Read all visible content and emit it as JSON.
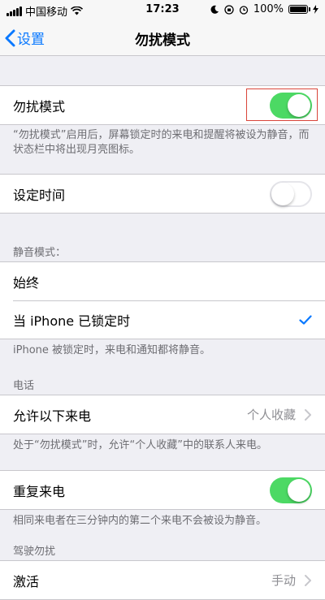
{
  "status_bar": {
    "carrier": "中国移动",
    "time": "17:23",
    "battery_text": "100%"
  },
  "nav": {
    "back_label": "设置",
    "title": "勿扰模式"
  },
  "dnd": {
    "label": "勿扰模式",
    "enabled": true,
    "footnote": "“勿扰模式”启用后，屏幕锁定时的来电和提醒将被设为静音，而状态栏中将出现月亮图标。"
  },
  "scheduled": {
    "label": "设定时间",
    "enabled": false
  },
  "silence": {
    "header": "静音模式：",
    "always_label": "始终",
    "locked_label": "当 iPhone 已锁定时",
    "footnote": "iPhone 被锁定时，来电和通知都将静音。"
  },
  "phone": {
    "header": "电话",
    "allow_label": "允许以下来电",
    "allow_value": "个人收藏",
    "footnote": "处于“勿扰模式”时，允许“个人收藏”中的联系人来电。",
    "repeat_label": "重复来电",
    "repeat_enabled": true,
    "repeat_footnote": "相同来电者在三分钟内的第二个来电不会被设为静音。"
  },
  "driving": {
    "header": "驾驶勿扰",
    "activate_label": "激活",
    "activate_value": "手动"
  },
  "colors": {
    "accent": "#0a79ff",
    "toggle_on": "#4cd964",
    "highlight": "#d9453a"
  }
}
